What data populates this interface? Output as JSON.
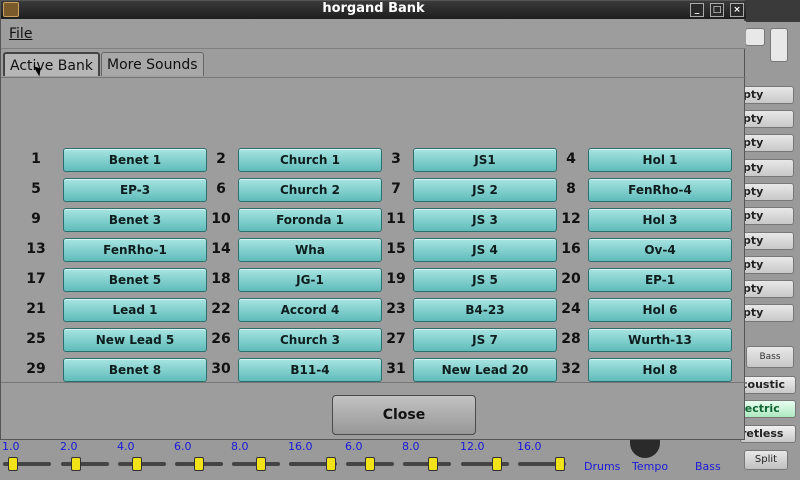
{
  "window": {
    "title": "horgand Bank",
    "min_label": "_",
    "max_label": "□",
    "close_label": "×"
  },
  "menu": {
    "file_label": "File"
  },
  "tabs": [
    {
      "label": "Active Bank",
      "active": true
    },
    {
      "label": "More Sounds",
      "active": false
    }
  ],
  "bank_slots": [
    {
      "num": "1",
      "name": "Benet 1"
    },
    {
      "num": "2",
      "name": "Church 1"
    },
    {
      "num": "3",
      "name": "JS1"
    },
    {
      "num": "4",
      "name": "Hol 1"
    },
    {
      "num": "5",
      "name": "EP-3"
    },
    {
      "num": "6",
      "name": "Church 2"
    },
    {
      "num": "7",
      "name": "JS 2"
    },
    {
      "num": "8",
      "name": "FenRho-4"
    },
    {
      "num": "9",
      "name": "Benet 3"
    },
    {
      "num": "10",
      "name": "Foronda 1"
    },
    {
      "num": "11",
      "name": "JS 3"
    },
    {
      "num": "12",
      "name": "Hol 3"
    },
    {
      "num": "13",
      "name": "FenRho-1"
    },
    {
      "num": "14",
      "name": "Wha"
    },
    {
      "num": "15",
      "name": "JS 4"
    },
    {
      "num": "16",
      "name": "Ov-4"
    },
    {
      "num": "17",
      "name": "Benet 5"
    },
    {
      "num": "18",
      "name": "JG-1"
    },
    {
      "num": "19",
      "name": "JS 5"
    },
    {
      "num": "20",
      "name": "EP-1"
    },
    {
      "num": "21",
      "name": "Lead 1"
    },
    {
      "num": "22",
      "name": "Accord 4"
    },
    {
      "num": "23",
      "name": "B4-23"
    },
    {
      "num": "24",
      "name": "Hol 6"
    },
    {
      "num": "25",
      "name": "New Lead 5"
    },
    {
      "num": "26",
      "name": "Church 3"
    },
    {
      "num": "27",
      "name": "JS 7"
    },
    {
      "num": "28",
      "name": "Wurth-13"
    },
    {
      "num": "29",
      "name": "Benet 8"
    },
    {
      "num": "30",
      "name": "B11-4"
    },
    {
      "num": "31",
      "name": "New Lead 20"
    },
    {
      "num": "32",
      "name": "Hol 8"
    }
  ],
  "close_button": {
    "label": "Close"
  },
  "background": {
    "side_buttons": [
      "pty",
      "pty",
      "pty",
      "pty",
      "pty",
      "pty",
      "pty",
      "pty",
      "pty",
      "pty"
    ],
    "bass_label": "Bass",
    "style_buttons": [
      {
        "label": "coustic",
        "selected": false
      },
      {
        "label": "lectric",
        "selected": true
      },
      {
        "label": "retless",
        "selected": false
      }
    ],
    "split_label": "Split",
    "fader_labels": [
      "1.0",
      "2.0",
      "4.0",
      "6.0",
      "8.0",
      "16.0",
      "6.0",
      "8.0",
      "12.0",
      "16.0"
    ],
    "knob_labels": {
      "drums": "Drums",
      "tempo": "Tempo",
      "bass": "Bass"
    }
  },
  "colors": {
    "bank_button": "#7fd0ce",
    "window_bg": "#9d9d9d",
    "titlebar": "#2a2a2a",
    "fader_label": "#1a1ad8",
    "fader_knob": "#f2e318"
  }
}
